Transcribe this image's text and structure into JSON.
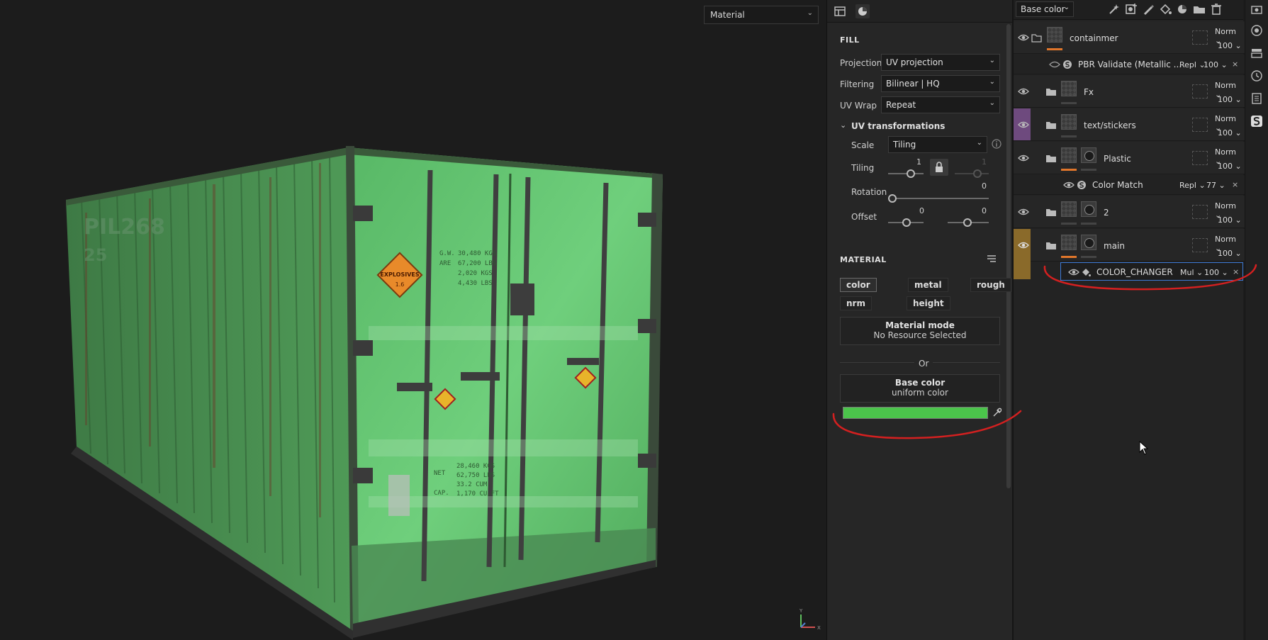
{
  "viewport": {
    "mode_select": "Material",
    "axis_labels": {
      "y": "Y",
      "x": "X"
    },
    "container_text": {
      "side_code": "PIL268",
      "side_sub": "25",
      "explosives_label": "EXPLOSIVES",
      "explosives_num": "1.6",
      "spec_left": [
        "G.W.",
        "ARE",
        "",
        ""
      ],
      "spec_right": [
        "30,480 KGS",
        "67,200 LBS",
        "2,020 KGS",
        "4,430 LBS"
      ],
      "spec2_left": [
        "NET",
        "",
        "CAP.",
        ""
      ],
      "spec2_right": [
        "28,460 KGS",
        "62,750 LBS",
        "33.2 CUM",
        "1,170 CU.FT"
      ]
    }
  },
  "props": {
    "fill_title": "FILL",
    "projection": {
      "label": "Projection",
      "value": "UV projection"
    },
    "filtering": {
      "label": "Filtering",
      "value": "Bilinear | HQ"
    },
    "uvwrap": {
      "label": "UV Wrap",
      "value": "Repeat"
    },
    "uvtrans_title": "UV transformations",
    "scale": {
      "label": "Scale",
      "value": "Tiling"
    },
    "tiling": {
      "label": "Tiling",
      "value1": "1",
      "value2": "1"
    },
    "rotation": {
      "label": "Rotation",
      "value": "0"
    },
    "offset": {
      "label": "Offset",
      "value1": "0",
      "value2": "0"
    },
    "material_title": "MATERIAL",
    "chips": [
      "color",
      "metal",
      "rough",
      "nrm",
      "height"
    ],
    "material_mode": {
      "line1": "Material mode",
      "line2": "No Resource Selected"
    },
    "or": "Or",
    "base_color": {
      "line1": "Base color",
      "line2": "uniform color"
    },
    "swatch_color": "#4bc44b"
  },
  "layers": {
    "channel": "Base color",
    "rows": [
      {
        "name": "containmer",
        "blend": "Norm",
        "opacity": "100"
      },
      {
        "name": "PBR Validate (Metallic ...",
        "blend": "Repl",
        "opacity": "100"
      },
      {
        "name": "Fx",
        "blend": "Norm",
        "opacity": "100"
      },
      {
        "name": "text/stickers",
        "blend": "Norm",
        "opacity": "100"
      },
      {
        "name": "Plastic",
        "blend": "Norm",
        "opacity": "100"
      },
      {
        "name": "Color Match",
        "blend": "Repl",
        "opacity": "77"
      },
      {
        "name": "2",
        "blend": "Norm",
        "opacity": "100"
      },
      {
        "name": "main",
        "blend": "Norm",
        "opacity": "100"
      },
      {
        "name": "COLOR_CHANGER",
        "blend": "Mul",
        "opacity": "100"
      }
    ],
    "close_symbol": "×"
  },
  "colors": {
    "accent_orange": "#e0762b",
    "folder_purple": "#6e4a7e",
    "folder_gold": "#8a6a2a",
    "annotation_red": "#d42020",
    "selection_blue": "#3d7ad6"
  }
}
